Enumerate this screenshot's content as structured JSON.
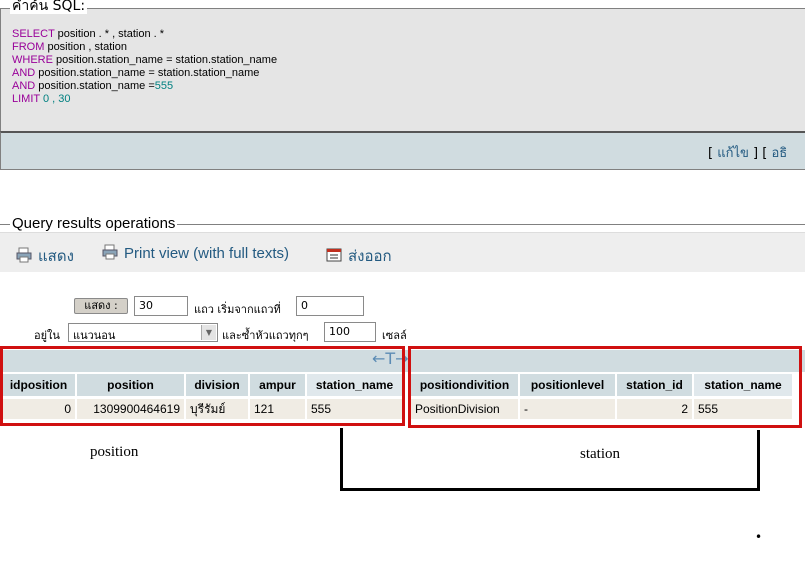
{
  "sql_box": {
    "legend": "คำค้น SQL:",
    "lines": [
      {
        "kw": "SELECT",
        "text": " position . * , station . *"
      },
      {
        "kw": "FROM",
        "text": " position , station"
      },
      {
        "kw": "WHERE",
        "text": " position.station_name = station.station_name"
      },
      {
        "kw": "AND",
        "text": " position.station_name = station.station_name"
      },
      {
        "kw": "AND",
        "text": " position.station_name =",
        "num": "555"
      },
      {
        "kw": "LIMIT",
        "text": "",
        "num": " 0 , 30"
      }
    ],
    "links": {
      "open": "[ ",
      "edit": "แก้ไข",
      "mid": " ] [ ",
      "explain": "อธิ"
    }
  },
  "operations": {
    "legend": "Query results operations",
    "show": "แสดง",
    "print_view": "Print view (with full texts)",
    "export": "ส่งออก"
  },
  "nav_form": {
    "show_button": "แสดง :",
    "rows": "30",
    "rows_label": "แถว เริ่มจากแถวที่",
    "start": "0",
    "in_label": "อยู่ใน",
    "mode": "แนวนอน",
    "repeat_label": "และซ้ำหัวแถวทุกๆ",
    "repeat": "100",
    "cells_label": "เซลล์"
  },
  "table": {
    "resize_glyph": "←T→",
    "position_headers": [
      "idposition",
      "position",
      "division",
      "ampur",
      "station_name"
    ],
    "station_headers": [
      "positiondivition",
      "positionlevel",
      "station_id",
      "station_name"
    ],
    "position_row": [
      "0",
      "1309900464619",
      "บุรีรัมย์",
      "121",
      "555"
    ],
    "station_row": [
      "PositionDivision",
      "-",
      "2",
      "555"
    ]
  },
  "annotations": {
    "position_caption": "position",
    "station_caption": "station",
    "dot": "•"
  },
  "colors": {
    "sql_keyword": "#990099",
    "sql_number": "#008080",
    "link": "#235a81",
    "highlight_box": "#d01010",
    "header_bg": "#d0dce0"
  }
}
